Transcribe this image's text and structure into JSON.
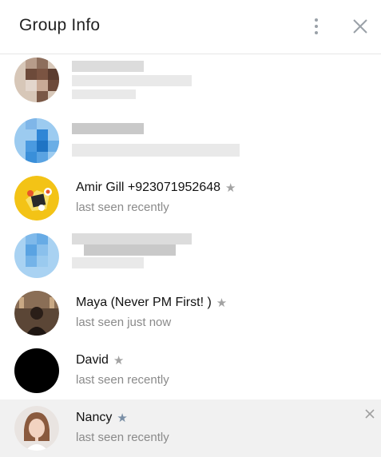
{
  "header": {
    "title": "Group Info",
    "menu_icon": "more-vertical-icon",
    "close_icon": "close-icon"
  },
  "members": [
    {
      "name": "",
      "status": "",
      "redacted": true
    },
    {
      "name": "",
      "status": "",
      "redacted": true
    },
    {
      "name": "Amir Gill +923071952648",
      "status": "last seen recently",
      "star": true
    },
    {
      "name": "",
      "status": "",
      "redacted": true
    },
    {
      "name": "Maya (Never PM First!  )",
      "status": "last seen just now",
      "star": true
    },
    {
      "name": "David",
      "status": "last seen recently",
      "star": true
    },
    {
      "name": "Nancy",
      "status": "last seen recently",
      "star": true,
      "selected": true,
      "removable": true
    }
  ],
  "colors": {
    "selected_row": "#f1f1f1",
    "status_text": "#8a8a8a",
    "star": "#a3a3a3",
    "star_selected": "#7a8fa6"
  }
}
